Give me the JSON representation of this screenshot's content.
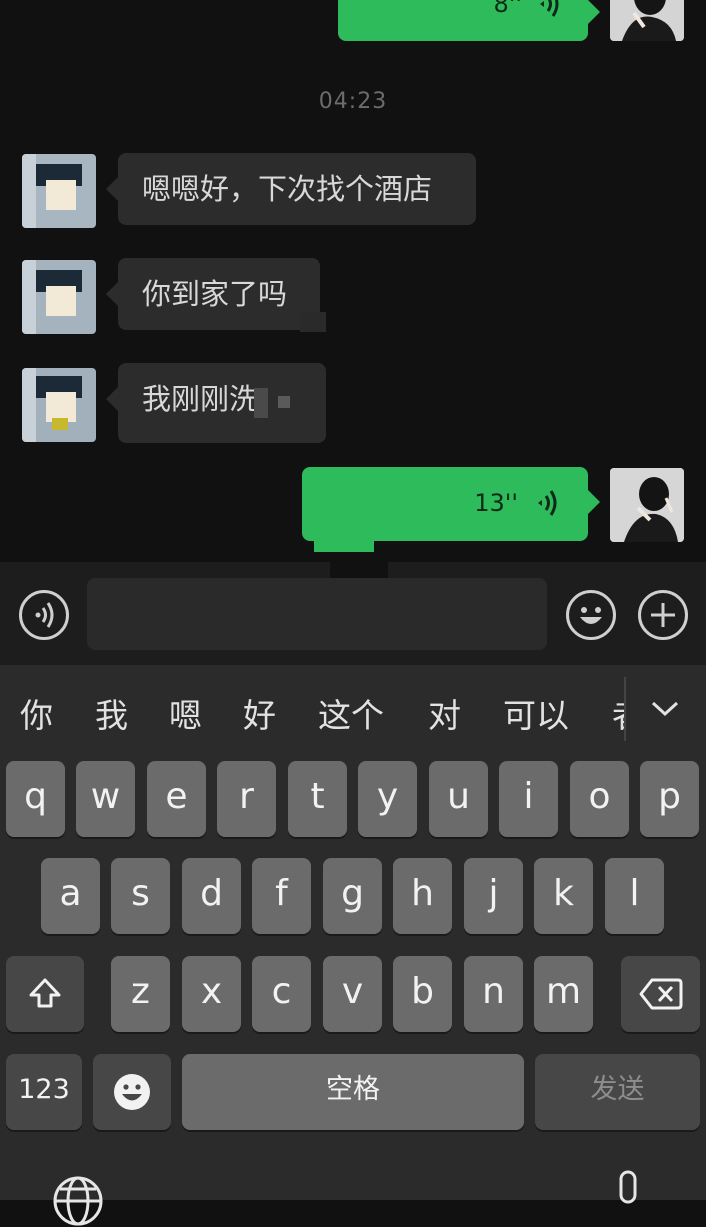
{
  "chat": {
    "time_label": "04:23",
    "messages": [
      {
        "side": "out",
        "type": "voice",
        "duration": "8''"
      },
      {
        "side": "in",
        "type": "text",
        "text": "嗯嗯好，下次找个酒店"
      },
      {
        "side": "in",
        "type": "text",
        "text": "你到家了吗"
      },
      {
        "side": "in",
        "type": "text",
        "text": "我刚刚洗"
      },
      {
        "side": "out",
        "type": "voice",
        "duration": "13''"
      }
    ]
  },
  "input_bar": {
    "voice_button_icon": "voice-mode-icon",
    "emoji_button_icon": "emoji-icon",
    "more_button_icon": "plus-icon",
    "text_value": ""
  },
  "keyboard": {
    "candidates": [
      "你",
      "我",
      "嗯",
      "好",
      "这个",
      "对",
      "可以",
      "者"
    ],
    "rows": [
      [
        "q",
        "w",
        "e",
        "r",
        "t",
        "y",
        "u",
        "i",
        "o",
        "p"
      ],
      [
        "a",
        "s",
        "d",
        "f",
        "g",
        "h",
        "j",
        "k",
        "l"
      ],
      [
        "z",
        "x",
        "c",
        "v",
        "b",
        "n",
        "m"
      ]
    ],
    "numbers_label": "123",
    "space_label": "空格",
    "send_label": "发送"
  },
  "colors": {
    "outgoing_bubble": "#2ebb5b",
    "incoming_bubble": "#2c2c2c",
    "background": "#111111"
  }
}
